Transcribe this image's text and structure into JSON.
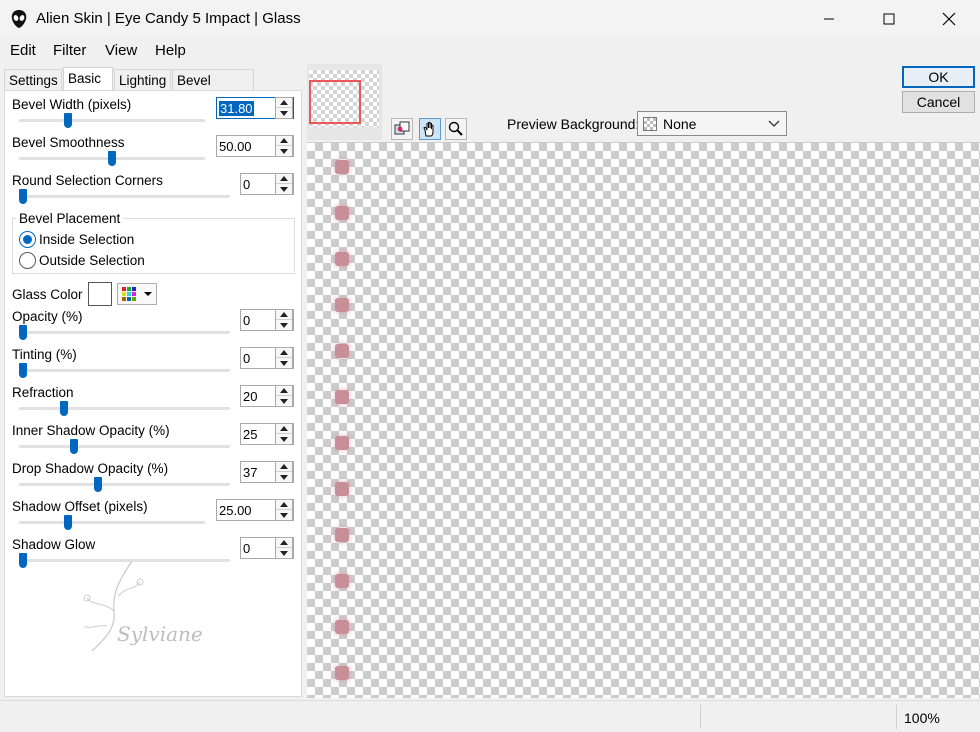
{
  "window": {
    "title": "Alien Skin | Eye Candy 5 Impact | Glass"
  },
  "menu": [
    "Edit",
    "Filter",
    "View",
    "Help"
  ],
  "tabs": [
    "Settings",
    "Basic",
    "Lighting",
    "Bevel Profile"
  ],
  "params": {
    "bevel_width": {
      "label": "Bevel Width (pixels)",
      "value": "31.80",
      "slider": 0.25
    },
    "bevel_smoothness": {
      "label": "Bevel Smoothness",
      "value": "50.00",
      "slider": 0.5
    },
    "round_corners": {
      "label": "Round Selection Corners",
      "value": "0",
      "slider": 0.0
    },
    "opacity": {
      "label": "Opacity (%)",
      "value": "0",
      "slider": 0.0
    },
    "tinting": {
      "label": "Tinting (%)",
      "value": "0",
      "slider": 0.0
    },
    "refraction": {
      "label": "Refraction",
      "value": "20",
      "slider": 0.2
    },
    "inner_shadow_opacity": {
      "label": "Inner Shadow Opacity (%)",
      "value": "25",
      "slider": 0.25
    },
    "drop_shadow_opacity": {
      "label": "Drop Shadow Opacity (%)",
      "value": "37",
      "slider": 0.37
    },
    "shadow_offset": {
      "label": "Shadow Offset (pixels)",
      "value": "25.00",
      "slider": 0.25
    },
    "shadow_glow": {
      "label": "Shadow Glow",
      "value": "0",
      "slider": 0.0
    }
  },
  "bevel_placement": {
    "title": "Bevel Placement",
    "options": [
      "Inside Selection",
      "Outside Selection"
    ],
    "selected": "Inside Selection"
  },
  "glass_color": {
    "label": "Glass Color",
    "color": "#ffffff"
  },
  "preview_background": {
    "label": "Preview Background:",
    "value": "None"
  },
  "buttons": {
    "ok": "OK",
    "cancel": "Cancel"
  },
  "status": {
    "zoom": "100%"
  },
  "watermark_text": "Sylviane",
  "colors": {
    "accent": "#0067c0",
    "nav_rect": "#e8585a",
    "preview_dot": "#c98f98"
  }
}
